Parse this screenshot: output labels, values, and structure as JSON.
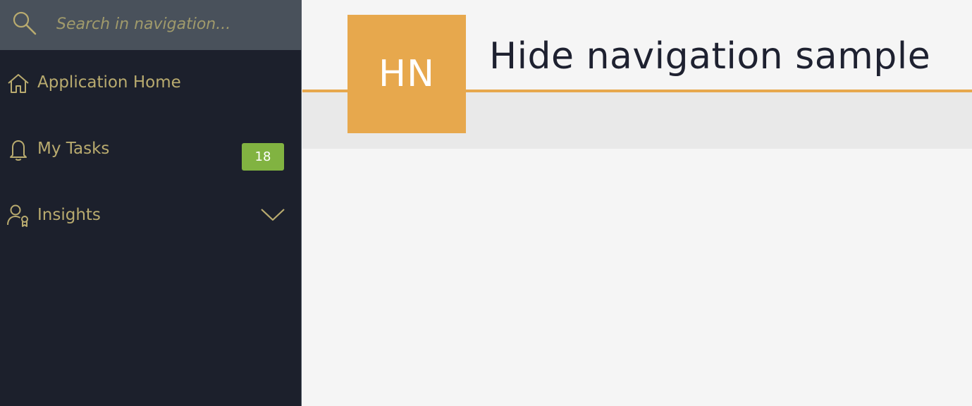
{
  "search": {
    "placeholder": "Search in navigation..."
  },
  "nav": {
    "items": [
      {
        "label": "Application Home",
        "icon": "home-icon"
      },
      {
        "label": "My Tasks",
        "icon": "bell-icon",
        "badge": "18"
      },
      {
        "label": "Insights",
        "icon": "user-award-icon",
        "expand_icon": "chevron-down-icon"
      }
    ]
  },
  "app": {
    "tile_text": "HN",
    "title": "Hide navigation sample"
  },
  "colors": {
    "sidebar_bg": "#1c202c",
    "search_bg": "#49515b",
    "nav_text": "#b9ab6f",
    "badge": "#81b341",
    "accent": "#e7a84d",
    "header_band": "#e9e9e9",
    "page_bg": "#f5f5f5"
  }
}
